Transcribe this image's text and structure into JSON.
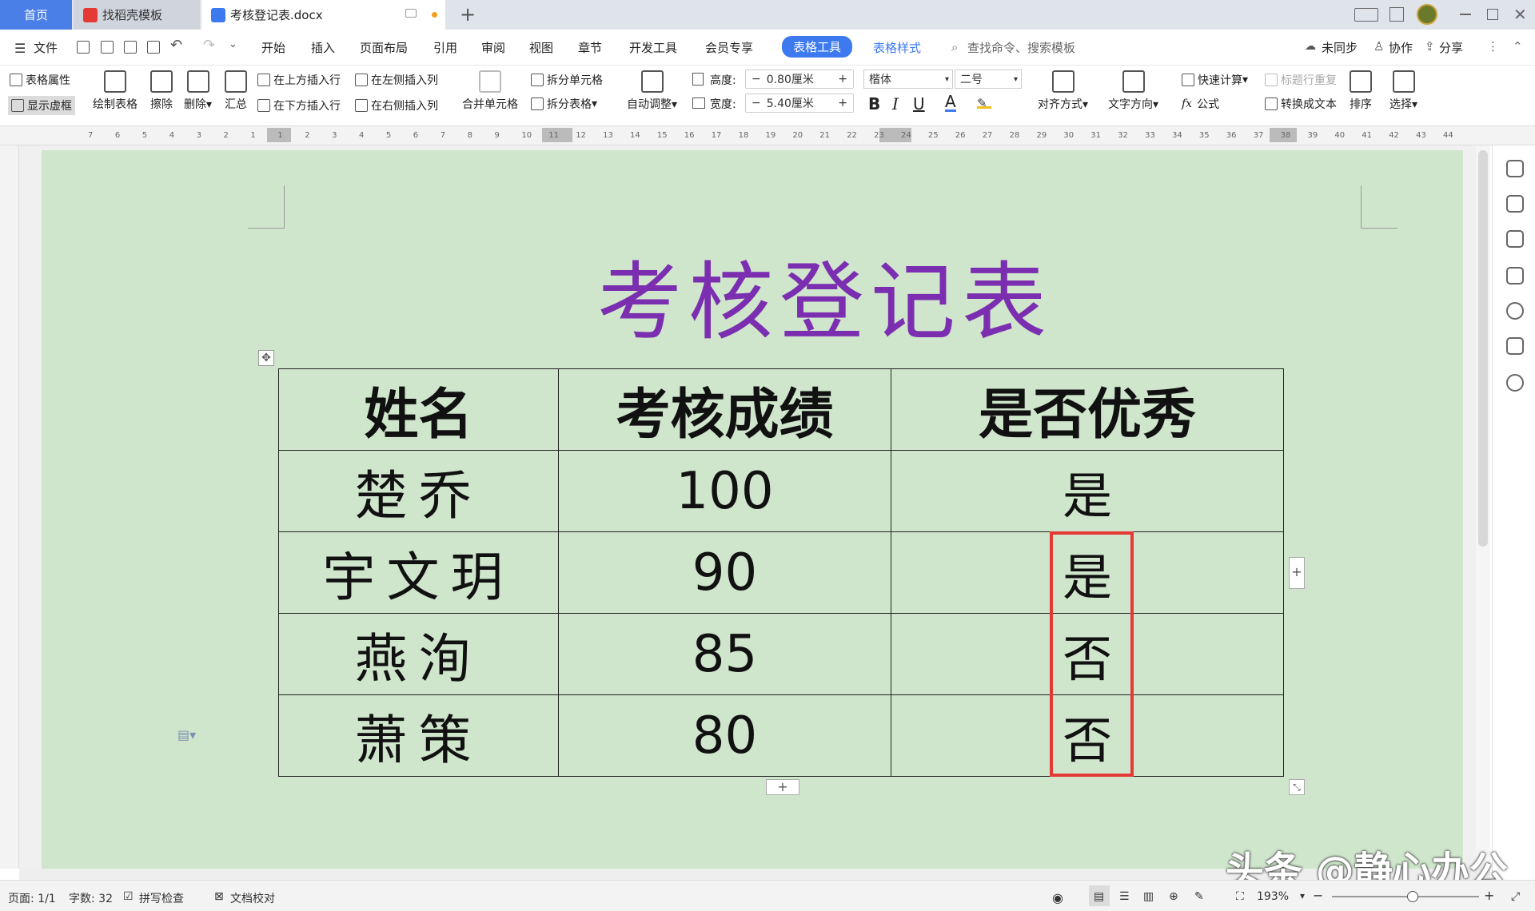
{
  "tabs": {
    "home": "首页",
    "find_template": "找稻壳模板",
    "document": "考核登记表.docx",
    "new_tab": "+"
  },
  "menu": {
    "file": "文件",
    "items": [
      "开始",
      "插入",
      "页面布局",
      "引用",
      "审阅",
      "视图",
      "章节",
      "开发工具",
      "会员专享"
    ],
    "active": "表格工具",
    "table_style": "表格样式",
    "search": "查找命令、搜索模板",
    "sync": "未同步",
    "collab": "协作",
    "share": "分享"
  },
  "ribbon": {
    "table_props": "表格属性",
    "show_gridlines": "显示虚框",
    "draw_table": "绘制表格",
    "erase": "擦除",
    "delete": "删除",
    "summary": "汇总",
    "insert_above": "在上方插入行",
    "insert_below": "在下方插入行",
    "insert_left": "在左侧插入列",
    "insert_right": "在右侧插入列",
    "merge_cells": "合并单元格",
    "split_cells": "拆分单元格",
    "split_table": "拆分表格",
    "auto_fit": "自动调整",
    "height_label": "高度:",
    "height_value": "0.80厘米",
    "width_label": "宽度:",
    "width_value": "5.40厘米",
    "font_name": "楷体",
    "font_size": "二号",
    "align": "对齐方式",
    "text_direction": "文字方向",
    "quick_calc": "快速计算",
    "repeat_header": "标题行重复",
    "formula": "公式",
    "convert_text": "转换成文本",
    "sort": "排序",
    "select": "选择"
  },
  "ruler_ticks": [
    "7",
    "6",
    "5",
    "4",
    "3",
    "2",
    "1",
    "1",
    "2",
    "3",
    "4",
    "5",
    "6",
    "7",
    "8",
    "9",
    "10",
    "11",
    "12",
    "13",
    "14",
    "15",
    "16",
    "17",
    "18",
    "19",
    "20",
    "21",
    "22",
    "23",
    "24",
    "25",
    "26",
    "27",
    "28",
    "29",
    "30",
    "31",
    "32",
    "33",
    "34",
    "35",
    "36",
    "37",
    "38",
    "39",
    "40",
    "41",
    "42",
    "43",
    "44"
  ],
  "document": {
    "title": "考核登记表",
    "headers": [
      "姓名",
      "考核成绩",
      "是否优秀"
    ],
    "rows": [
      {
        "name": "楚乔",
        "score": "100",
        "excellent": "是"
      },
      {
        "name": "宇文玥",
        "score": "90",
        "excellent": "是"
      },
      {
        "name": "燕洵",
        "score": "85",
        "excellent": "否"
      },
      {
        "name": "萧策",
        "score": "80",
        "excellent": "否"
      }
    ]
  },
  "status": {
    "page": "页面: 1/1",
    "word_count": "字数: 32",
    "spell_check": "拼写检查",
    "doc_check": "文档校对",
    "zoom": "193%"
  },
  "watermark": "头条 @静心办公",
  "colors": {
    "page_bg": "#cfe6cc",
    "title_purple": "#7b2eb0",
    "highlight_red": "#e53935",
    "accent_blue": "#3d7af0"
  }
}
